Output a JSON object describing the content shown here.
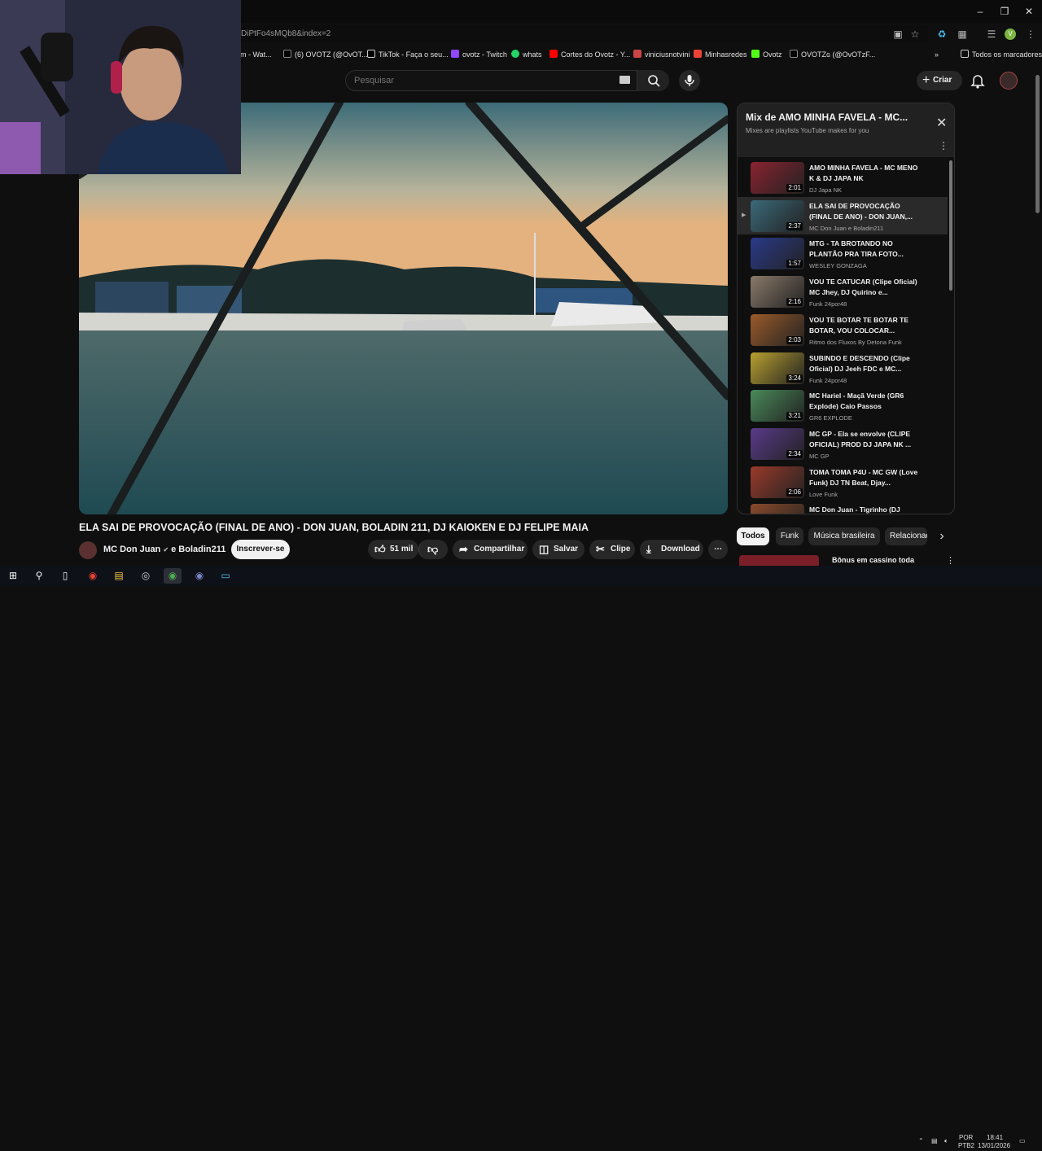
{
  "browser": {
    "url_fragment": "DiPtFo4sMQb8&index=2",
    "bookmarks": [
      {
        "label": "am - Wat...",
        "icon": "whatsapp-icon"
      },
      {
        "label": "(6) OVOTZ (@OvOT...",
        "icon": "x-icon"
      },
      {
        "label": "TikTok - Faça o seu...",
        "icon": "tiktok-icon"
      },
      {
        "label": "ovotz - Twitch",
        "icon": "twitch-icon"
      },
      {
        "label": "whats",
        "icon": "whatsapp-icon"
      },
      {
        "label": "Cortes do Ovotz - Y...",
        "icon": "youtube-icon"
      },
      {
        "label": "viniciusnotvini",
        "icon": "bookmark-icon"
      },
      {
        "label": "Minhasredes",
        "icon": "gmail-icon"
      },
      {
        "label": "Ovotz",
        "icon": "kick-icon"
      },
      {
        "label": "OVOTZɢ (@OvOTzF...",
        "icon": "x-icon"
      }
    ],
    "bookmarks_folder": "Todos os marcadores",
    "profile_initial": "V"
  },
  "youtube": {
    "search_placeholder": "Pesquisar",
    "create_label": "Criar"
  },
  "video": {
    "title": "ELA SAI DE PROVOCAÇÃO (FINAL DE ANO) - DON JUAN, BOLADIN 211, DJ KAIOKEN E DJ FELIPE MAIA",
    "channel": "MC Don Juan",
    "channel_suffix": "e Boladin211",
    "subscribe_label": "Inscrever-se",
    "likes": "51 mil",
    "share_label": "Compartilhar",
    "save_label": "Salvar",
    "clip_label": "Clipe",
    "download_label": "Download"
  },
  "playlist": {
    "title": "Mix de AMO MINHA FAVELA - MC...",
    "subtitle": "Mixes are playlists YouTube makes for you",
    "items": [
      {
        "title": "AMO MINHA FAVELA - MC MENO K & DJ JAPA NK",
        "channel": "DJ Japa NK",
        "duration": "2:01",
        "color": "#8a2330"
      },
      {
        "title": "ELA SAI DE PROVOCAÇÃO (FINAL DE ANO) - DON JUAN,...",
        "channel": "MC Don Juan e Boladin211",
        "duration": "2:37",
        "color": "#3b6a7a"
      },
      {
        "title": "MTG - TA BROTANDO NO PLANTÃO PRA TIRA FOTO...",
        "channel": "WESLEY GONZAGA",
        "duration": "1:57",
        "color": "#2a3a8a"
      },
      {
        "title": "VOU TE CATUCAR (Clipe Oficial) MC Jhey, DJ Quirino e...",
        "channel": "Funk 24por48",
        "duration": "2:16",
        "color": "#8a7a6a"
      },
      {
        "title": "VOU TE BOTAR TE BOTAR TE BOTAR, VOU COLOCAR...",
        "channel": "Ritmo dos Fluxos By Detona Funk",
        "duration": "2:03",
        "color": "#9a5a2a"
      },
      {
        "title": "SUBINDO E DESCENDO (Clipe Oficial) DJ Jeeh FDC e MC...",
        "channel": "Funk 24por48",
        "duration": "3:24",
        "color": "#b8a030"
      },
      {
        "title": "MC Hariel - Maçã Verde (GR6 Explode) Caio Passos",
        "channel": "GR6 EXPLODE",
        "duration": "3:21",
        "color": "#4a8a5a"
      },
      {
        "title": "MC GP - Ela se envolve (CLIPE OFICIAL) PROD DJ JAPA NK ...",
        "channel": "MC GP",
        "duration": "2:34",
        "color": "#5a3a8a"
      },
      {
        "title": "TOMA TOMA P4U - MC GW (Love Funk) DJ TN Beat, Djay...",
        "channel": "Love Funk",
        "duration": "2:06",
        "color": "#9a3a2a"
      },
      {
        "title": "MC Don Juan - Tigrinho (DJ",
        "channel": "",
        "duration": "",
        "color": "#8a4a2a"
      }
    ]
  },
  "chips": [
    "Todos",
    "Funk",
    "Música brasileira",
    "Relacionados"
  ],
  "suggestion": {
    "title": "Bônus em cassino toda"
  },
  "taskbar": {
    "lang": "POR",
    "layout": "PTB2",
    "time": "18:41",
    "date": "13/01/2026"
  }
}
